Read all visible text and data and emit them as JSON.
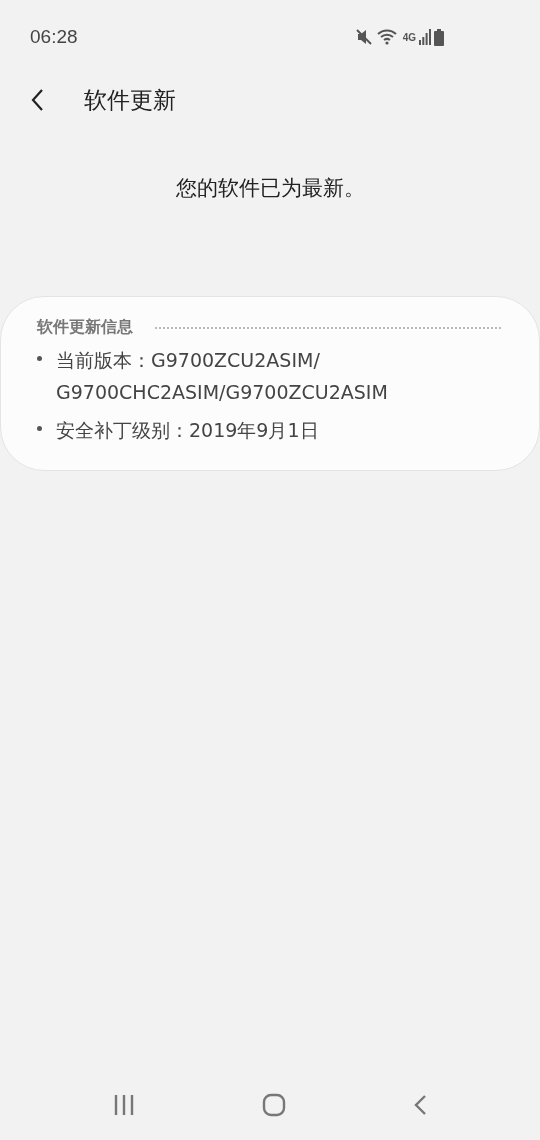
{
  "status_bar": {
    "time": "06:28",
    "network": "4G"
  },
  "header": {
    "title": "软件更新"
  },
  "message": "您的软件已为最新。",
  "info_card": {
    "heading": "软件更新信息",
    "items": [
      {
        "label": "当前版本：",
        "value": "G9700ZCU2ASIM/ G9700CHC2ASIM/G9700ZCU2ASIM"
      },
      {
        "label": "安全补丁级别：",
        "value": "2019年9月1日"
      }
    ]
  }
}
